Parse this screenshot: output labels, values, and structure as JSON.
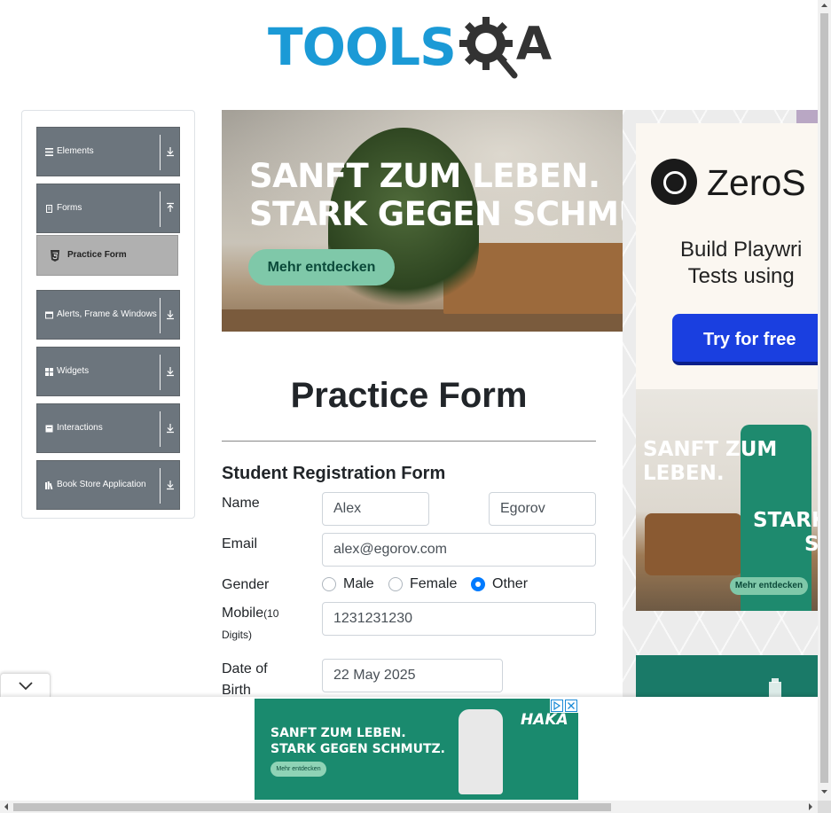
{
  "header": {
    "logo_text": "TOOLS",
    "logo_suffix": "A"
  },
  "sidebar": {
    "groups": [
      {
        "label": "Elements",
        "icon": "list-icon",
        "expanded": false
      },
      {
        "label": "Forms",
        "icon": "document-icon",
        "expanded": true
      },
      {
        "label": "Alerts, Frame & Windows",
        "icon": "window-icon",
        "expanded": false
      },
      {
        "label": "Widgets",
        "icon": "grid-icon",
        "expanded": false
      },
      {
        "label": "Interactions",
        "icon": "square-icon",
        "expanded": false
      },
      {
        "label": "Book Store Application",
        "icon": "books-icon",
        "expanded": false
      }
    ],
    "forms_items": [
      {
        "label": "Practice Form",
        "icon": "html5-icon",
        "active": true
      }
    ]
  },
  "ads": {
    "top": {
      "headline_line1": "SANFT ZUM LEBEN.",
      "headline_line2": "STARK GEGEN SCHMU",
      "cta": "Mehr entdecken"
    },
    "right": {
      "brand": "ZeroS",
      "tagline_line1": "Build Playwri",
      "tagline_line2": "Tests using",
      "cta": "Try for free",
      "photo_line1": "SANFT ZUM",
      "photo_line2": "LEBEN.",
      "photo_line3": "STARK G",
      "photo_line4": "SCH",
      "photo_cta": "Mehr entdecken"
    },
    "bottom": {
      "headline_line1": "SANFT ZUM LEBEN.",
      "headline_line2": "STARK GEGEN SCHMUTZ.",
      "cta": "Mehr entdecken",
      "brand": "HAKA"
    }
  },
  "form": {
    "title": "Practice Form",
    "subtitle": "Student Registration Form",
    "name_label": "Name",
    "first_name": "Alex",
    "last_name": "Egorov",
    "email_label": "Email",
    "email": "alex@egorov.com",
    "gender_label": "Gender",
    "gender_options": [
      "Male",
      "Female",
      "Other"
    ],
    "gender_selected": "Other",
    "mobile_label": "Mobile",
    "mobile_hint": "(10",
    "mobile_hint2": "Digits)",
    "mobile": "1231231230",
    "dob_label_line1": "Date of",
    "dob_label_line2": "Birth",
    "dob": "22 May 2025"
  },
  "colors": {
    "brand_blue": "#1b9ad6",
    "sidebar_group": "#6c757d",
    "active_item": "#b0b0b0",
    "radio_checked": "#007bff",
    "ad_green": "#1a8a6e"
  }
}
